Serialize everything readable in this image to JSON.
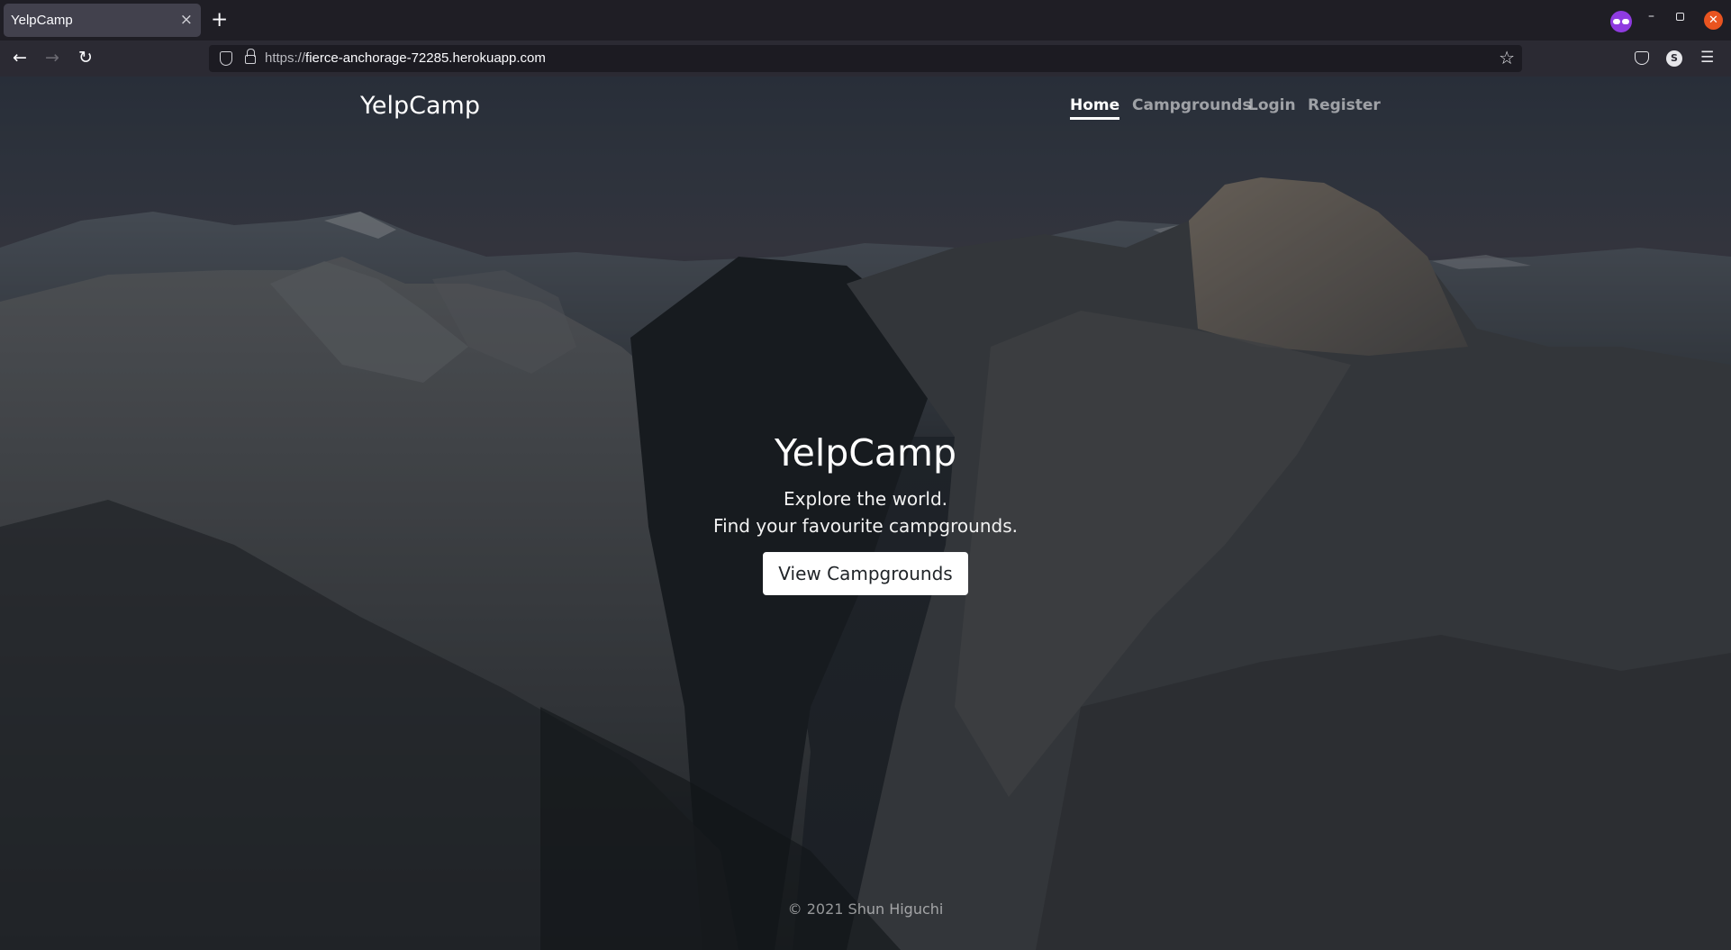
{
  "browser": {
    "tab_title": "YelpCamp",
    "tab_close": "×",
    "new_tab": "+",
    "url_scheme": "https://",
    "url_host": "fierce-anchorage-72285.herokuapp.com",
    "account_initial": "S",
    "icons": [
      "private-browsing-icon",
      "back-icon",
      "forward-icon",
      "reload-icon",
      "shield-icon",
      "lock-icon",
      "bookmark-star-icon",
      "pocket-icon",
      "account-icon",
      "hamburger-menu-icon"
    ]
  },
  "site": {
    "brand": "YelpCamp",
    "nav": [
      {
        "label": "Home",
        "active": true
      },
      {
        "label": "Campgrounds",
        "active": false
      },
      {
        "label": "Login",
        "active": false
      },
      {
        "label": "Register",
        "active": false
      }
    ],
    "hero": {
      "title": "YelpCamp",
      "line1": "Explore the world.",
      "line2": "Find your favourite campgrounds.",
      "button": "View Campgrounds"
    },
    "footer": "© 2021 Shun Higuchi"
  },
  "colors": {
    "tab_bar": "#1f1e25",
    "toolbar": "#2b2a33",
    "url_field": "#1c1b22",
    "private_accent": "#8f3be0",
    "close_accent": "#e95420",
    "button_bg": "#ffffff"
  }
}
